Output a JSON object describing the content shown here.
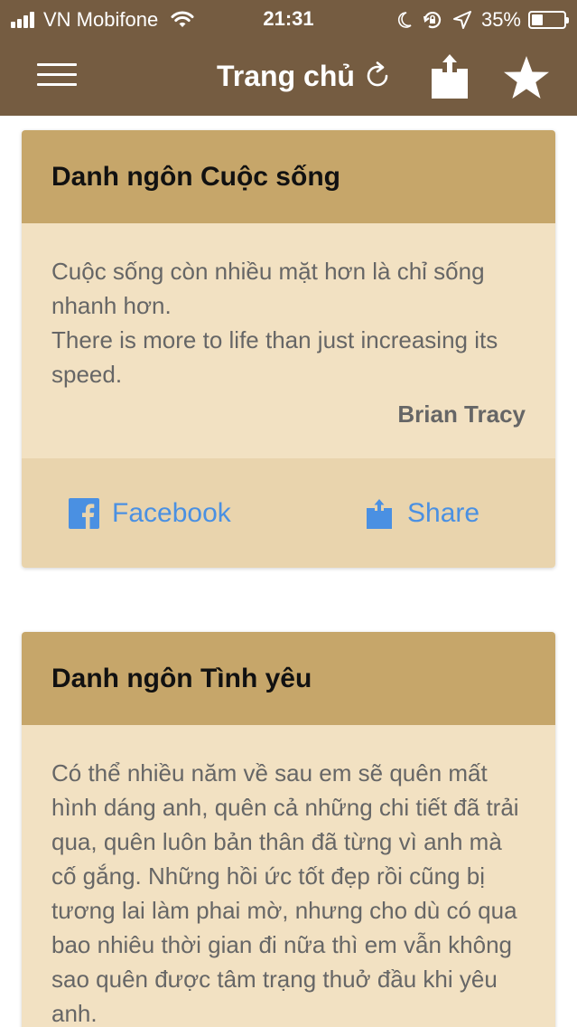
{
  "status_bar": {
    "carrier": "VN Mobifone",
    "time": "21:31",
    "battery_percent": "35%",
    "battery_level": 0.35,
    "icons": [
      "signal-icon",
      "wifi-icon",
      "moon-icon",
      "rotation-lock-icon",
      "location-arrow-icon",
      "battery-icon"
    ]
  },
  "nav": {
    "title": "Trang chủ",
    "icons": [
      "menu-icon",
      "refresh-icon",
      "share-icon",
      "star-icon"
    ]
  },
  "colors": {
    "nav_background": "#755c41",
    "card_header": "#c6a66a",
    "card_body": "#f2e1c2",
    "card_actions": "#e9d4ad",
    "link": "#4a90e2"
  },
  "cards": [
    {
      "title": "Danh ngôn Cuộc sống",
      "quote_vi": "Cuộc sống còn nhiều mặt hơn là chỉ sống nhanh hơn.",
      "quote_en": "There is more to life than just increasing its speed.",
      "author": "Brian Tracy",
      "actions": {
        "facebook_label": "Facebook",
        "share_label": "Share"
      }
    },
    {
      "title": "Danh ngôn Tình yêu",
      "quote_vi": "Có thể nhiều năm về sau em sẽ quên mất hình dáng anh, quên cả những chi tiết đã trải qua, quên luôn bản thân đã từng vì anh mà cố gắng. Những hồi ức tốt đẹp rồi cũng bị tương lai làm phai mờ, nhưng cho dù có qua bao nhiêu thời gian đi nữa thì em vẫn không sao quên được tâm trạng thuở đầu khi yêu anh."
    }
  ]
}
